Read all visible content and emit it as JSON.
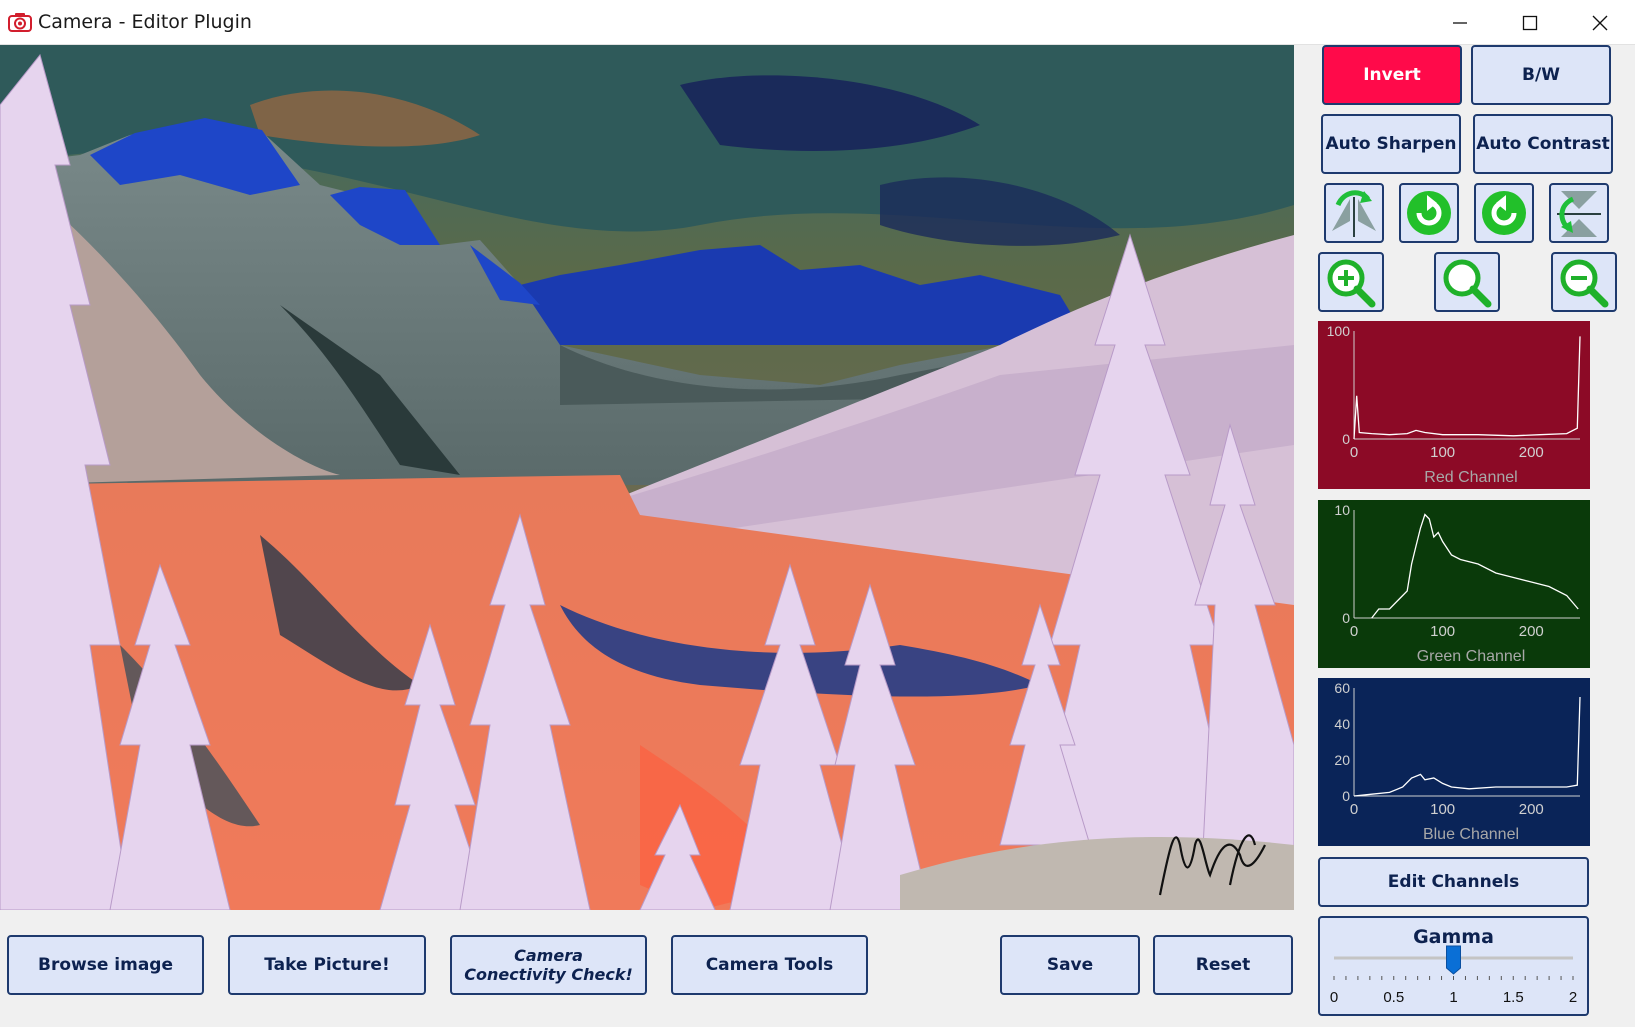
{
  "window": {
    "title": "Camera - Editor Plugin",
    "controls": {
      "minimize": "minimize-icon",
      "maximize": "maximize-icon",
      "close": "close-icon"
    }
  },
  "image": {
    "description_icon": "photo-canvas",
    "signature_visible": true
  },
  "toolbar_right": {
    "invert_label": "Invert",
    "bw_label": "B/W",
    "auto_sharpen_label": "Auto Sharpen",
    "auto_contrast_label": "Auto Contrast",
    "icon_buttons": [
      "flip-horizontal-icon",
      "rotate-clockwise-icon",
      "rotate-counterclockwise-icon",
      "flip-vertical-icon",
      "zoom-in-icon",
      "zoom-reset-icon",
      "zoom-out-icon"
    ],
    "edit_channels_label": "Edit Channels"
  },
  "histograms": [
    {
      "name": "Red Channel",
      "bg": "#8c0a26",
      "yticks": [
        "100",
        "0"
      ],
      "xticks": [
        "0",
        "100",
        "200"
      ],
      "ymax": 100,
      "points": [
        [
          0,
          0
        ],
        [
          3,
          40
        ],
        [
          6,
          6
        ],
        [
          20,
          5
        ],
        [
          40,
          4
        ],
        [
          60,
          5
        ],
        [
          70,
          8
        ],
        [
          80,
          6
        ],
        [
          100,
          4
        ],
        [
          140,
          4
        ],
        [
          180,
          3
        ],
        [
          210,
          4
        ],
        [
          240,
          5
        ],
        [
          252,
          10
        ],
        [
          255,
          95
        ]
      ]
    },
    {
      "name": "Green Channel",
      "bg": "#0a3a0a",
      "yticks": [
        "10",
        "0"
      ],
      "xticks": [
        "0",
        "100",
        "200"
      ],
      "ymax": 12,
      "points": [
        [
          20,
          0
        ],
        [
          28,
          1
        ],
        [
          40,
          1
        ],
        [
          50,
          2
        ],
        [
          60,
          3
        ],
        [
          65,
          6
        ],
        [
          70,
          8
        ],
        [
          75,
          10
        ],
        [
          80,
          11.5
        ],
        [
          85,
          11
        ],
        [
          90,
          9
        ],
        [
          95,
          9.5
        ],
        [
          100,
          8.5
        ],
        [
          110,
          7
        ],
        [
          120,
          6.5
        ],
        [
          140,
          6
        ],
        [
          160,
          5
        ],
        [
          180,
          4.5
        ],
        [
          200,
          4
        ],
        [
          220,
          3.5
        ],
        [
          240,
          2.5
        ],
        [
          253,
          1
        ]
      ]
    },
    {
      "name": "Blue Channel",
      "bg": "#0a2458",
      "yticks": [
        "60",
        "40",
        "20",
        "0"
      ],
      "xticks": [
        "0",
        "100",
        "200"
      ],
      "ymax": 60,
      "points": [
        [
          0,
          0
        ],
        [
          20,
          1
        ],
        [
          40,
          2
        ],
        [
          55,
          5
        ],
        [
          65,
          10
        ],
        [
          75,
          12
        ],
        [
          80,
          9
        ],
        [
          90,
          10
        ],
        [
          100,
          7
        ],
        [
          110,
          5
        ],
        [
          130,
          4
        ],
        [
          160,
          5
        ],
        [
          200,
          5
        ],
        [
          240,
          5
        ],
        [
          252,
          6
        ],
        [
          255,
          55
        ]
      ]
    }
  ],
  "bottom_buttons": {
    "browse_label": "Browse image",
    "take_picture_label": "Take Picture!",
    "camera_check_line1": "Camera",
    "camera_check_line2": "Conectivity Check!",
    "camera_tools_label": "Camera Tools",
    "save_label": "Save",
    "reset_label": "Reset"
  },
  "gamma": {
    "title": "Gamma",
    "value": 1.0,
    "min": 0,
    "max": 2,
    "tick_labels": [
      "0",
      "0.5",
      "1",
      "1.5",
      "2"
    ]
  },
  "colors": {
    "accent": "#1e3a6e",
    "button_bg": "#dde5f8",
    "invert_active": "#ff0a4a"
  }
}
